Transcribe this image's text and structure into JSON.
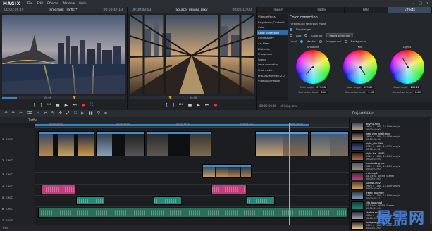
{
  "app": {
    "logo": "MAGIX",
    "menus": [
      "File",
      "Edit",
      "Effects",
      "Window",
      "Help"
    ],
    "window_buttons": [
      "–",
      "□",
      "×"
    ]
  },
  "program_monitor": {
    "timecode_left": "00:00:06:19",
    "title": "Program: Traffic *",
    "timecode_right": "00:00:47:19",
    "scrub_label": "00:06",
    "progress": 0.12
  },
  "source_monitor": {
    "timecode_left": "00:00:03:03",
    "title": "Source: driving.mxv",
    "timecode_right": "00:00:10:00",
    "scrub_label": "00:06",
    "progress": 0.0
  },
  "effects": {
    "tabs": [
      "Import",
      "Fades",
      "Title",
      "Effects"
    ],
    "active_tab": "Effects",
    "list": [
      "Video effects",
      "Brightness/Contrast",
      "Color",
      "Color correction",
      "Chroma key",
      "Art filter",
      "Distortion",
      "Sharpness",
      "Speed",
      "Lens correction",
      "Shot match",
      "proDAD Mercalli 2.0",
      "Video/Animation"
    ],
    "selected": "Color correction",
    "panel_title": "Color correction",
    "foreground_label": "Foreground selection mode",
    "no_changes": "No changes",
    "add": "Add",
    "subtract": "Subtract",
    "reset_selection": "Reset selection",
    "level_label": "Level",
    "master": "Master",
    "foreground": "Foreground",
    "background": "Background",
    "wheels": [
      {
        "label": "Shadows",
        "angle": 130
      },
      {
        "label": "Mid",
        "angle": 55
      },
      {
        "label": "Lights",
        "angle": 240
      }
    ],
    "values": [
      {
        "label": "Color angle",
        "value": "273.88"
      },
      {
        "label": "Color angle",
        "value": "129.69"
      },
      {
        "label": "Color angle",
        "value": "205.22"
      }
    ],
    "values2": [
      {
        "label": "Correction level",
        "value": "0.10"
      },
      {
        "label": "Correction level",
        "value": "1.03"
      },
      {
        "label": "Correction level",
        "value": "1.04"
      }
    ],
    "footer_timecode": "00:00:00:00",
    "footer_file": "driving.mxv"
  },
  "toolbar": {
    "icons": [
      "↶",
      "↷",
      "✂",
      "⌫",
      "⇋",
      "⇌",
      "✎",
      "✥",
      "⤢",
      "☐",
      "▶",
      "▮▮",
      "⚲",
      "≡"
    ],
    "project_folder": "Project folder"
  },
  "arranger": {
    "tab": "Traffic",
    "ruler_ticks": [
      "00:00:06:00",
      "00:00:24:00",
      "00:00:36:00",
      "00:00:42:00",
      "00:00:48:00"
    ],
    "tracks": [
      {
        "num": "1",
        "name": "S M ☐"
      },
      {
        "num": "2",
        "name": "S M ☐"
      },
      {
        "num": "3",
        "name": "S M ☐"
      },
      {
        "num": "4",
        "name": "S M ☐"
      },
      {
        "num": "5",
        "name": "S M ☐"
      },
      {
        "num": "6",
        "name": "S M ☐"
      },
      {
        "num": "7",
        "name": "S M ☐"
      }
    ],
    "zoom_label": "69%"
  },
  "project_folder": {
    "items": [
      {
        "file": "driving.mxv",
        "meta": "1920 × 1080, 25.00 frame/s",
        "dur": "00:00:10:00"
      },
      {
        "file": "new_york_night.mxv",
        "meta": "1920 × 1080, 25.00 frame/s",
        "dur": "00:00:08:00"
      },
      {
        "file": "night_sky.MXV",
        "meta": "1920 × 1080, 29.97 frame/s",
        "dur": "00:00:10:02"
      },
      {
        "file": "night tra...4080",
        "meta": "1920 × 1080, 25.00 frame/s",
        "dur": "00:00:15:03"
      },
      {
        "file": "overlooking.mxv",
        "meta": "3840 × 2160, 25.00 frame/s",
        "dur": "00:00:22:00"
      },
      {
        "file": "train.mp3",
        "meta": "44.1 kHz, 16 Bit, Stereo",
        "dur": "00:00:21:00"
      },
      {
        "file": "sunrise.mxv",
        "meta": "1920 × 1080, 25.00 frame/s",
        "dur": "00:00:05:00"
      },
      {
        "file": "traffic_day.mxv",
        "meta": "1920 × 1080, 25.00 frame/s",
        "dur": "00:00:05:11"
      },
      {
        "file": "city_tour.mp3",
        "meta": "44.1 kHz, 16 Bit, Stereo",
        "dur": "00:00:41:00"
      },
      {
        "file": "skyline.mxv",
        "meta": "1920 × 1080, 25.00 frame/s",
        "dur": "00:00:09:00"
      },
      {
        "file": "bridge.mxv",
        "meta": "1920 × 1080, 25.00 frame/s",
        "dur": "00:00:07:00"
      }
    ]
  },
  "watermark": "最需网",
  "colors": {
    "accent": "#2f86c8",
    "playhead": "#e3a12a",
    "pink_clip": "#c23d7c",
    "teal_clip": "#1f8a7a"
  }
}
